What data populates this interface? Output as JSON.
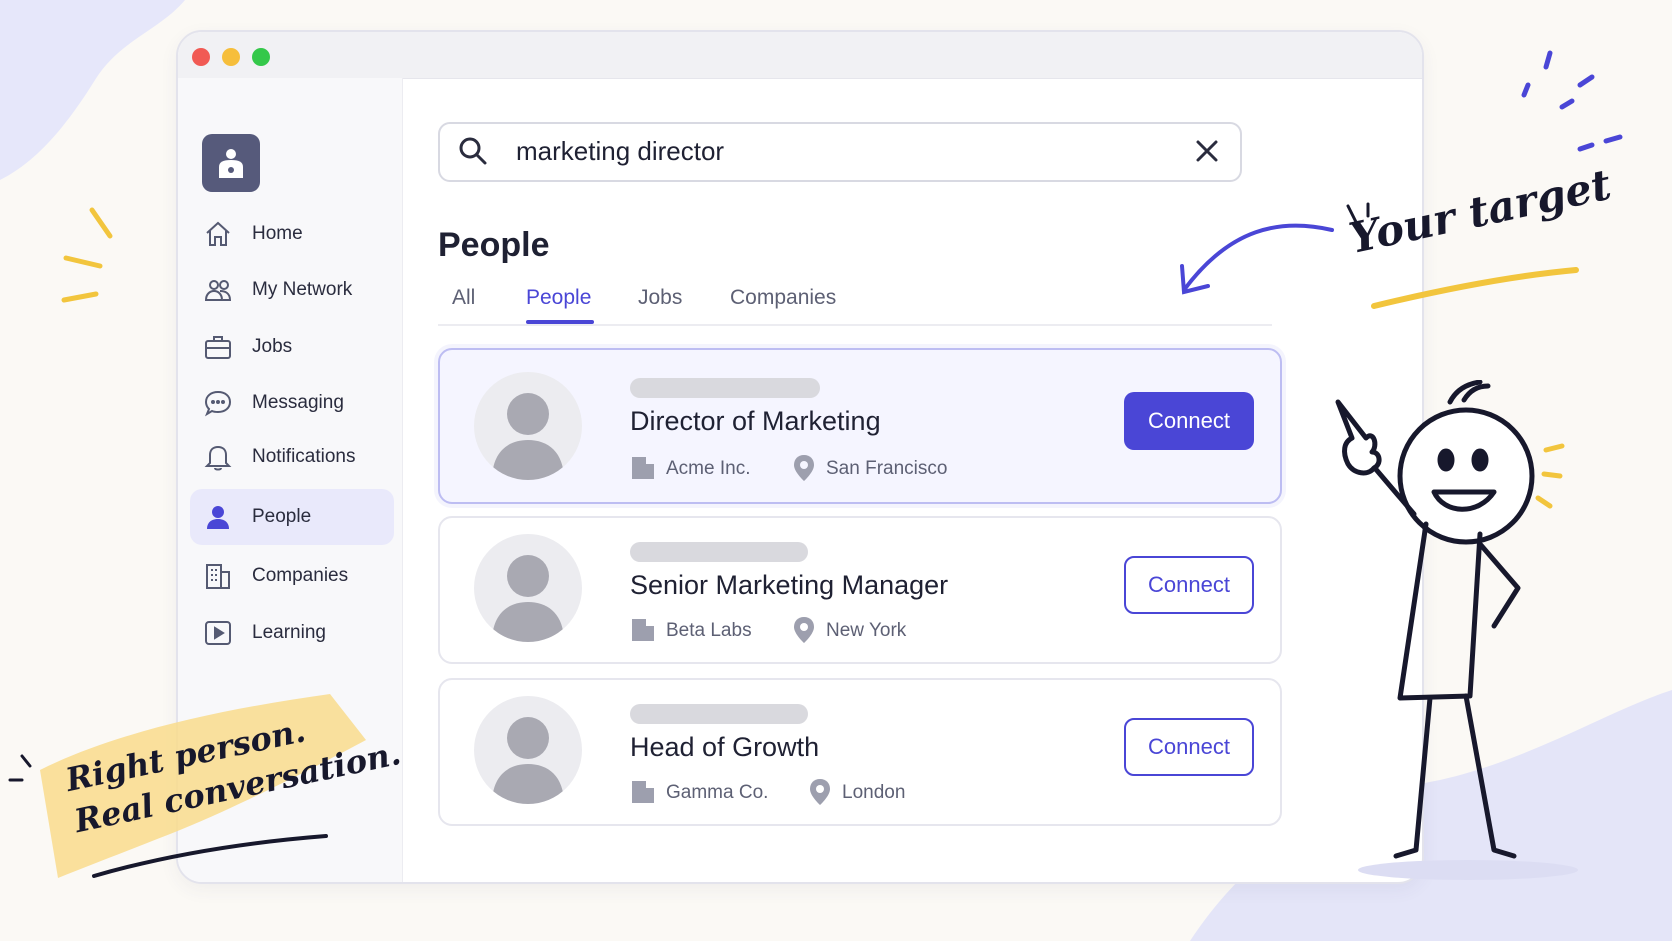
{
  "colors": {
    "accent": "#4a46d6",
    "highlight_bg": "#f5f5ff",
    "sidebar_active": "#e9e9fb",
    "mac_red": "#f15a54",
    "mac_yellow": "#f6be3b",
    "mac_green": "#34c84a"
  },
  "window": {
    "controls": [
      "close",
      "minimize",
      "maximize"
    ]
  },
  "sidebar": {
    "logo_icon": "person-badge-icon",
    "items": [
      {
        "label": "Home",
        "icon": "home-icon"
      },
      {
        "label": "My Network",
        "icon": "network-icon"
      },
      {
        "label": "Jobs",
        "icon": "briefcase-icon"
      },
      {
        "label": "Messaging",
        "icon": "chat-icon"
      },
      {
        "label": "Notifications",
        "icon": "bell-icon"
      },
      {
        "label": "People",
        "icon": "person-icon",
        "active": true
      },
      {
        "label": "Companies",
        "icon": "building-icon"
      },
      {
        "label": "Learning",
        "icon": "play-icon"
      }
    ]
  },
  "search": {
    "value": "marketing director"
  },
  "section": {
    "title": "People"
  },
  "tabs": [
    {
      "label": "All"
    },
    {
      "label": "People",
      "active": true
    },
    {
      "label": "Jobs"
    },
    {
      "label": "Companies"
    }
  ],
  "results": [
    {
      "title": "Director of Marketing",
      "company": "Acme Inc.",
      "location": "San Francisco",
      "action": "Connect",
      "highlighted": true
    },
    {
      "title": "Senior Marketing Manager",
      "company": "Beta Labs",
      "location": "New York",
      "action": "Connect"
    },
    {
      "title": "Head of Growth",
      "company": "Gamma Co.",
      "location": "London",
      "action": "Connect"
    }
  ],
  "annotations": {
    "target_note": "Your target",
    "tagline_line1": "Right person.",
    "tagline_line2": "Real conversation."
  }
}
